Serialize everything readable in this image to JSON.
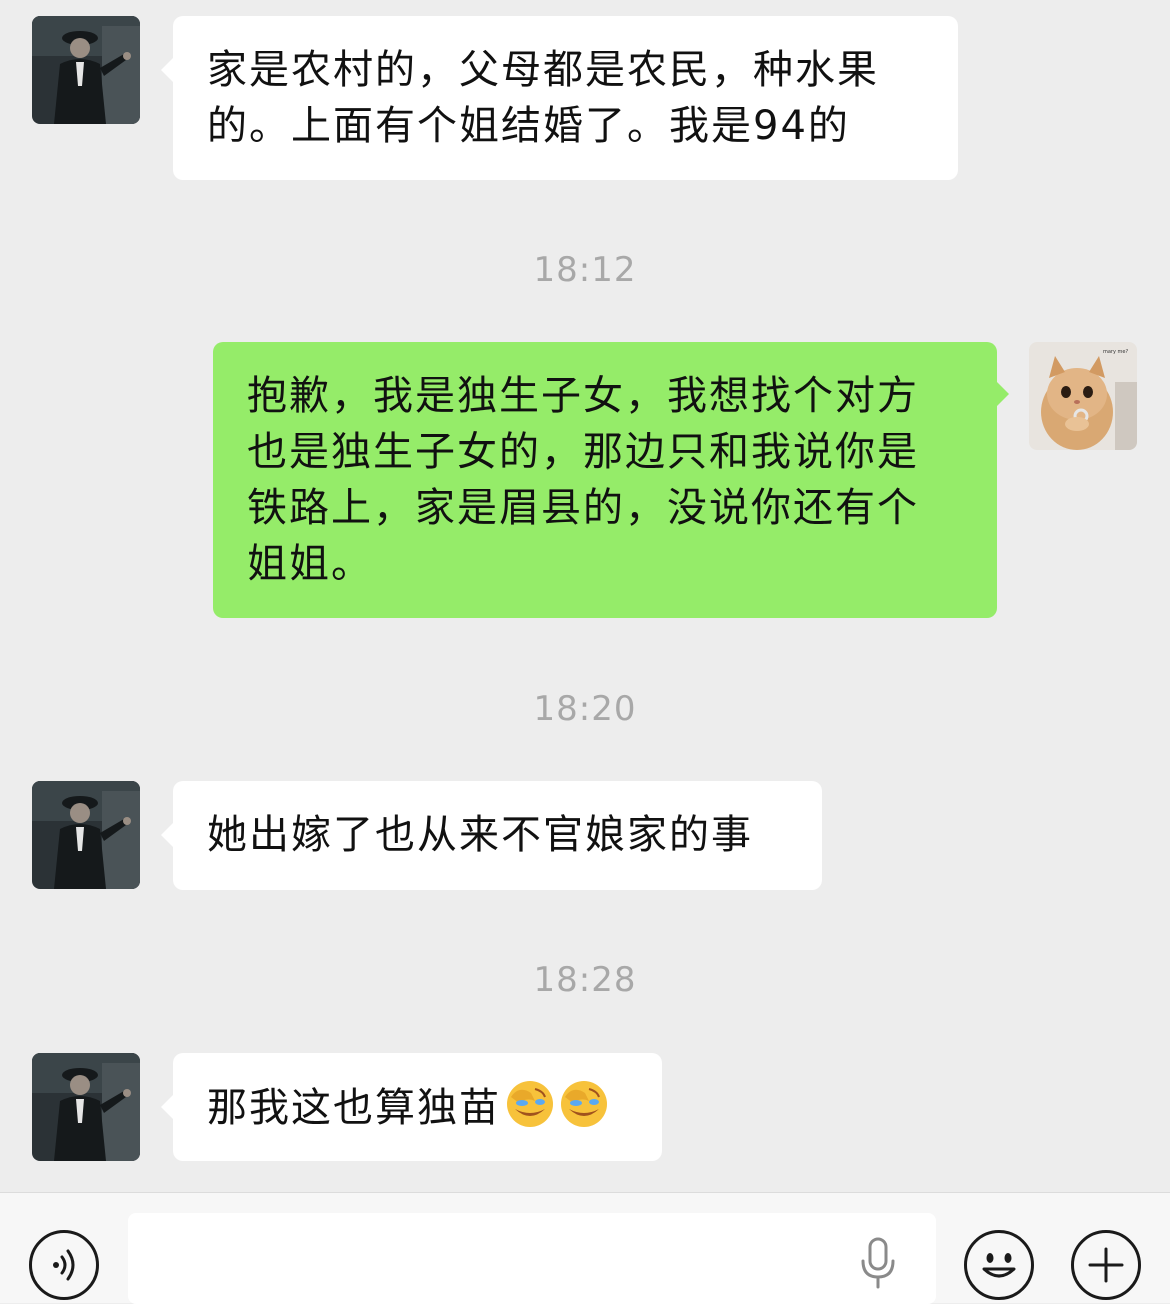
{
  "messages": [
    {
      "side": "in",
      "lines": [
        "家是农村的，父母都是农民，种水果",
        "的。上面有个姐结婚了。我是94的"
      ]
    },
    {
      "time": "18:12"
    },
    {
      "side": "out",
      "lines": [
        "抱歉，我是独生子女，我想找个对方",
        "也是独生子女的，那边只和我说你是",
        "铁路上，家是眉县的，没说你还有个",
        "姐姐。"
      ]
    },
    {
      "time": "18:20"
    },
    {
      "side": "in",
      "lines": [
        "她出嫁了也从来不官娘家的事"
      ]
    },
    {
      "time": "18:28"
    },
    {
      "side": "in",
      "lines": [
        "那我这也算独苗"
      ],
      "emoji_name": "facepalm-crying-emoji"
    }
  ],
  "self_avatar_caption": "mary me?",
  "input": {
    "value": "",
    "placeholder": ""
  },
  "icons": {
    "voice": "voice-icon",
    "mic": "microphone-icon",
    "emoji": "emoji-icon",
    "plus": "plus-icon"
  }
}
